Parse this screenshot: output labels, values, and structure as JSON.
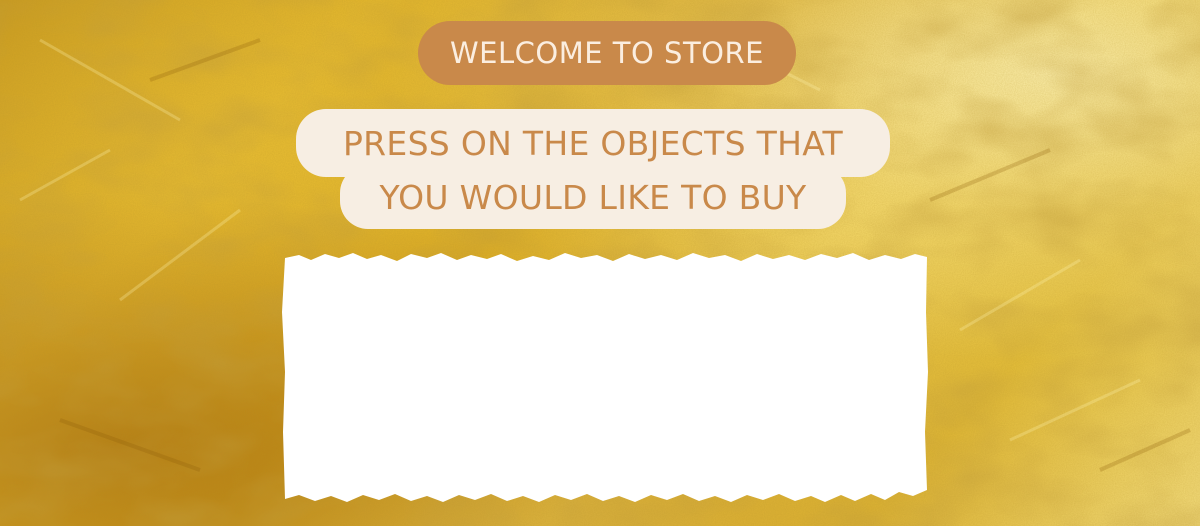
{
  "store": {
    "welcome_label": "WELCOME TO STORE",
    "instruction_line1": "PRESS ON THE OBJECTS THAT",
    "instruction_line2": "YOU WOULD LIKE TO BUY"
  },
  "colors": {
    "background": "#e3b62c",
    "badge_bg": "#c9894a",
    "badge_text": "#fbeee0",
    "instruction_bg": "#f7eee3",
    "instruction_text": "#c9894a",
    "panel": "#ffffff"
  }
}
